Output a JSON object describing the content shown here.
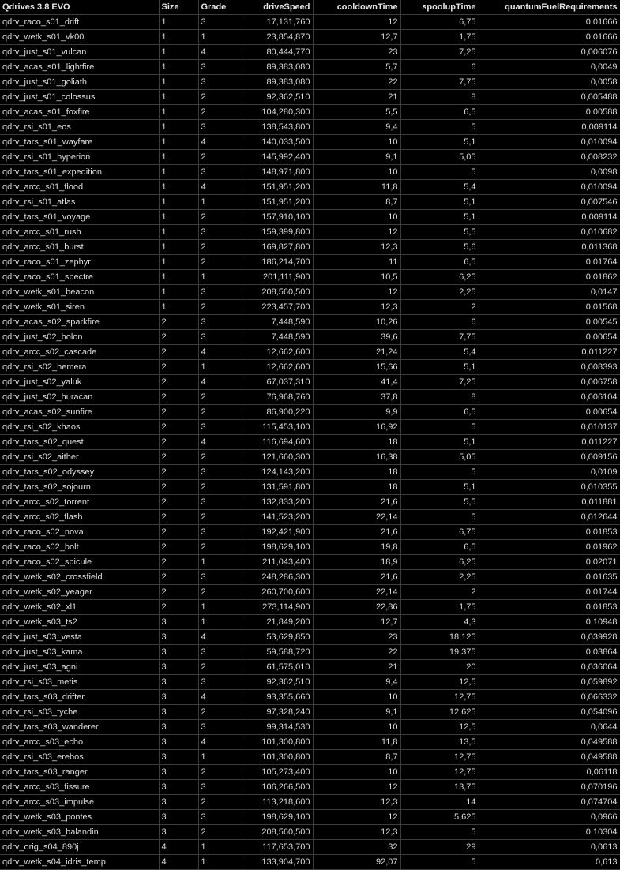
{
  "sheet": {
    "headers": [
      "Qdrives 3.8 EVO",
      "Size",
      "Grade",
      "driveSpeed",
      "cooldownTime",
      "spoolupTime",
      "quantumFuelRequirements"
    ],
    "rows": [
      [
        "qdrv_raco_s01_drift",
        "1",
        "3",
        "17,131,760",
        "12",
        "6,75",
        "0,01666"
      ],
      [
        "qdrv_wetk_s01_vk00",
        "1",
        "1",
        "23,854,870",
        "12,7",
        "1,75",
        "0,01666"
      ],
      [
        "qdrv_just_s01_vulcan",
        "1",
        "4",
        "80,444,770",
        "23",
        "7,25",
        "0,006076"
      ],
      [
        "qdrv_acas_s01_lightfire",
        "1",
        "3",
        "89,383,080",
        "5,7",
        "6",
        "0,0049"
      ],
      [
        "qdrv_just_s01_goliath",
        "1",
        "3",
        "89,383,080",
        "22",
        "7,75",
        "0,0058"
      ],
      [
        "qdrv_just_s01_colossus",
        "1",
        "2",
        "92,362,510",
        "21",
        "8",
        "0,005488"
      ],
      [
        "qdrv_acas_s01_foxfire",
        "1",
        "2",
        "104,280,300",
        "5,5",
        "6,5",
        "0,00588"
      ],
      [
        "qdrv_rsi_s01_eos",
        "1",
        "3",
        "138,543,800",
        "9,4",
        "5",
        "0,009114"
      ],
      [
        "qdrv_tars_s01_wayfare",
        "1",
        "4",
        "140,033,500",
        "10",
        "5,1",
        "0,010094"
      ],
      [
        "qdrv_rsi_s01_hyperion",
        "1",
        "2",
        "145,992,400",
        "9,1",
        "5,05",
        "0,008232"
      ],
      [
        "qdrv_tars_s01_expedition",
        "1",
        "3",
        "148,971,800",
        "10",
        "5",
        "0,0098"
      ],
      [
        "qdrv_arcc_s01_flood",
        "1",
        "4",
        "151,951,200",
        "11,8",
        "5,4",
        "0,010094"
      ],
      [
        "qdrv_rsi_s01_atlas",
        "1",
        "1",
        "151,951,200",
        "8,7",
        "5,1",
        "0,007546"
      ],
      [
        "qdrv_tars_s01_voyage",
        "1",
        "2",
        "157,910,100",
        "10",
        "5,1",
        "0,009114"
      ],
      [
        "qdrv_arcc_s01_rush",
        "1",
        "3",
        "159,399,800",
        "12",
        "5,5",
        "0,010682"
      ],
      [
        "qdrv_arcc_s01_burst",
        "1",
        "2",
        "169,827,800",
        "12,3",
        "5,6",
        "0,011368"
      ],
      [
        "qdrv_raco_s01_zephyr",
        "1",
        "2",
        "186,214,700",
        "11",
        "6,5",
        "0,01764"
      ],
      [
        "qdrv_raco_s01_spectre",
        "1",
        "1",
        "201,111,900",
        "10,5",
        "6,25",
        "0,01862"
      ],
      [
        "qdrv_wetk_s01_beacon",
        "1",
        "3",
        "208,560,500",
        "12",
        "2,25",
        "0,0147"
      ],
      [
        "qdrv_wetk_s01_siren",
        "1",
        "2",
        "223,457,700",
        "12,3",
        "2",
        "0,01568"
      ],
      [
        "qdrv_acas_s02_sparkfire",
        "2",
        "3",
        "7,448,590",
        "10,26",
        "6",
        "0,00545"
      ],
      [
        "qdrv_just_s02_bolon",
        "2",
        "3",
        "7,448,590",
        "39,6",
        "7,75",
        "0,00654"
      ],
      [
        "qdrv_arcc_s02_cascade",
        "2",
        "4",
        "12,662,600",
        "21,24",
        "5,4",
        "0,011227"
      ],
      [
        "qdrv_rsi_s02_hemera",
        "2",
        "1",
        "12,662,600",
        "15,66",
        "5,1",
        "0,008393"
      ],
      [
        "qdrv_just_s02_yaluk",
        "2",
        "4",
        "67,037,310",
        "41,4",
        "7,25",
        "0,006758"
      ],
      [
        "qdrv_just_s02_huracan",
        "2",
        "2",
        "76,968,760",
        "37,8",
        "8",
        "0,006104"
      ],
      [
        "qdrv_acas_s02_sunfire",
        "2",
        "2",
        "86,900,220",
        "9,9",
        "6,5",
        "0,00654"
      ],
      [
        "qdrv_rsi_s02_khaos",
        "2",
        "3",
        "115,453,100",
        "16,92",
        "5",
        "0,010137"
      ],
      [
        "qdrv_tars_s02_quest",
        "2",
        "4",
        "116,694,600",
        "18",
        "5,1",
        "0,011227"
      ],
      [
        "qdrv_rsi_s02_aither",
        "2",
        "2",
        "121,660,300",
        "16,38",
        "5,05",
        "0,009156"
      ],
      [
        "qdrv_tars_s02_odyssey",
        "2",
        "3",
        "124,143,200",
        "18",
        "5",
        "0,0109"
      ],
      [
        "qdrv_tars_s02_sojourn",
        "2",
        "2",
        "131,591,800",
        "18",
        "5,1",
        "0,010355"
      ],
      [
        "qdrv_arcc_s02_torrent",
        "2",
        "3",
        "132,833,200",
        "21,6",
        "5,5",
        "0,011881"
      ],
      [
        "qdrv_arcc_s02_flash",
        "2",
        "2",
        "141,523,200",
        "22,14",
        "5",
        "0,012644"
      ],
      [
        "qdrv_raco_s02_nova",
        "2",
        "3",
        "192,421,900",
        "21,6",
        "6,75",
        "0,01853"
      ],
      [
        "qdrv_raco_s02_bolt",
        "2",
        "2",
        "198,629,100",
        "19,8",
        "6,5",
        "0,01962"
      ],
      [
        "qdrv_raco_s02_spicule",
        "2",
        "1",
        "211,043,400",
        "18,9",
        "6,25",
        "0,02071"
      ],
      [
        "qdrv_wetk_s02_crossfield",
        "2",
        "3",
        "248,286,300",
        "21,6",
        "2,25",
        "0,01635"
      ],
      [
        "qdrv_wetk_s02_yeager",
        "2",
        "2",
        "260,700,600",
        "22,14",
        "2",
        "0,01744"
      ],
      [
        "qdrv_wetk_s02_xl1",
        "2",
        "1",
        "273,114,900",
        "22,86",
        "1,75",
        "0,01853"
      ],
      [
        "qdrv_wetk_s03_ts2",
        "3",
        "1",
        "21,849,200",
        "12,7",
        "4,3",
        "0,10948"
      ],
      [
        "qdrv_just_s03_vesta",
        "3",
        "4",
        "53,629,850",
        "23",
        "18,125",
        "0,039928"
      ],
      [
        "qdrv_just_s03_kama",
        "3",
        "3",
        "59,588,720",
        "22",
        "19,375",
        "0,03864"
      ],
      [
        "qdrv_just_s03_agni",
        "3",
        "2",
        "61,575,010",
        "21",
        "20",
        "0,036064"
      ],
      [
        "qdrv_rsi_s03_metis",
        "3",
        "3",
        "92,362,510",
        "9,4",
        "12,5",
        "0,059892"
      ],
      [
        "qdrv_tars_s03_drifter",
        "3",
        "4",
        "93,355,660",
        "10",
        "12,75",
        "0,066332"
      ],
      [
        "qdrv_rsi_s03_tyche",
        "3",
        "2",
        "97,328,240",
        "9,1",
        "12,625",
        "0,054096"
      ],
      [
        "qdrv_tars_s03_wanderer",
        "3",
        "3",
        "99,314,530",
        "10",
        "12,5",
        "0,0644"
      ],
      [
        "qdrv_arcc_s03_echo",
        "3",
        "4",
        "101,300,800",
        "11,8",
        "13,5",
        "0,049588"
      ],
      [
        "qdrv_rsi_s03_erebos",
        "3",
        "1",
        "101,300,800",
        "8,7",
        "12,75",
        "0,049588"
      ],
      [
        "qdrv_tars_s03_ranger",
        "3",
        "2",
        "105,273,400",
        "10",
        "12,75",
        "0,06118"
      ],
      [
        "qdrv_arcc_s03_fissure",
        "3",
        "3",
        "106,266,500",
        "12",
        "13,75",
        "0,070196"
      ],
      [
        "qdrv_arcc_s03_impulse",
        "3",
        "2",
        "113,218,600",
        "12,3",
        "14",
        "0,074704"
      ],
      [
        "qdrv_wetk_s03_pontes",
        "3",
        "3",
        "198,629,100",
        "12",
        "5,625",
        "0,0966"
      ],
      [
        "qdrv_wetk_s03_balandin",
        "3",
        "2",
        "208,560,500",
        "12,3",
        "5",
        "0,10304"
      ],
      [
        "qdrv_orig_s04_890j",
        "4",
        "1",
        "117,653,700",
        "32",
        "29",
        "0,0613"
      ],
      [
        "qdrv_wetk_s04_idris_temp",
        "4",
        "1",
        "133,904,700",
        "92,07",
        "5",
        "0,613"
      ]
    ]
  }
}
